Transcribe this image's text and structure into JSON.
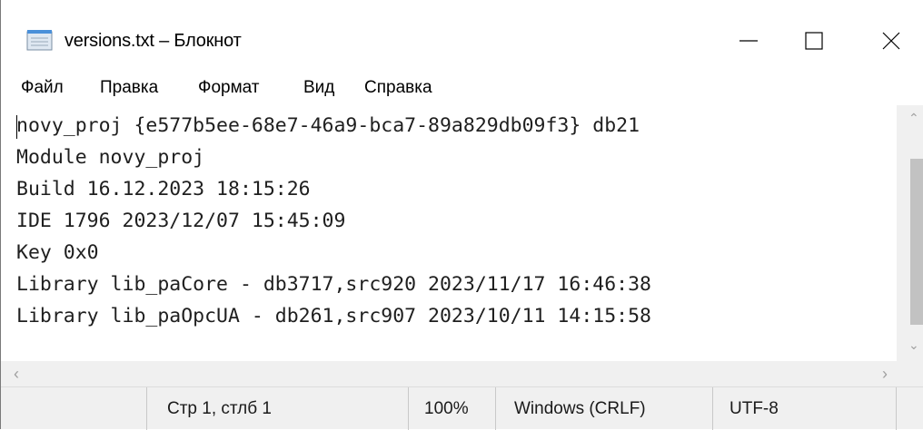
{
  "window": {
    "title": "versions.txt – Блокнот",
    "app_icon": "notepad-icon"
  },
  "controls": {
    "minimize": "minimize-icon",
    "maximize": "maximize-icon",
    "close": "close-icon"
  },
  "menu": {
    "items": [
      {
        "label": "Файл"
      },
      {
        "label": "Правка"
      },
      {
        "label": "Формат"
      },
      {
        "label": "Вид"
      },
      {
        "label": "Справка"
      }
    ]
  },
  "editor": {
    "lines": [
      "novy_proj {e577b5ee-68e7-46a9-bca7-89a829db09f3} db21",
      "Module novy_proj",
      "Build 16.12.2023 18:15:26",
      "IDE 1796 2023/12/07 15:45:09",
      "Key 0x0",
      "Library lib_paCore - db3717,src920 2023/11/17 16:46:38",
      "Library lib_paOpcUA - db261,src907 2023/10/11 14:15:58"
    ]
  },
  "status": {
    "position": "Стр 1, стлб 1",
    "zoom": "100%",
    "line_endings": "Windows (CRLF)",
    "encoding": "UTF-8"
  }
}
